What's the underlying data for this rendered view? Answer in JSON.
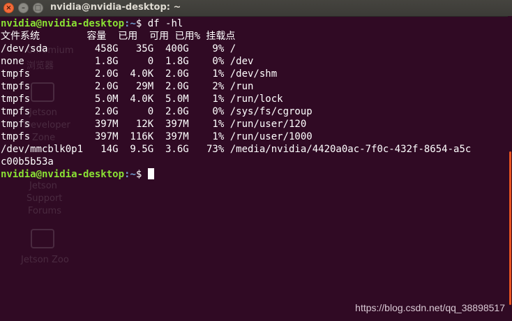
{
  "window": {
    "title": "nvidia@nvidia-desktop: ~",
    "close_glyph": "×",
    "min_glyph": "–",
    "max_glyph": "□"
  },
  "prompt": {
    "user_host": "nvidia@nvidia-desktop",
    "path": ":~",
    "symbol": "$ "
  },
  "command": "df -hl",
  "output_lines": [
    "文件系统        容量  已用  可用 已用% 挂载点",
    "/dev/sda        458G   35G  400G    9% /",
    "none            1.8G     0  1.8G    0% /dev",
    "tmpfs           2.0G  4.0K  2.0G    1% /dev/shm",
    "tmpfs           2.0G   29M  2.0G    2% /run",
    "tmpfs           5.0M  4.0K  5.0M    1% /run/lock",
    "tmpfs           2.0G     0  2.0G    0% /sys/fs/cgroup",
    "tmpfs           397M   12K  397M    1% /run/user/120",
    "tmpfs           397M  116K  397M    1% /run/user/1000",
    "/dev/mmcblk0p1   14G  9.5G  3.6G   73% /media/nvidia/4420a0ac-7f0c-432f-8654-a5c",
    "c00b5b53a"
  ],
  "desktop_ghost": {
    "items": [
      "Chromium",
      "浏览器",
      "Jetson",
      "Developer",
      "Zone",
      "Jetson",
      "Support",
      "Forums",
      "Jetson Zoo"
    ]
  },
  "watermark": "https://blog.csdn.net/qq_38898517",
  "colors": {
    "background": "#300a24",
    "prompt_user": "#8ae234",
    "prompt_path": "#729fcf",
    "scrollbar": "#e95420"
  }
}
